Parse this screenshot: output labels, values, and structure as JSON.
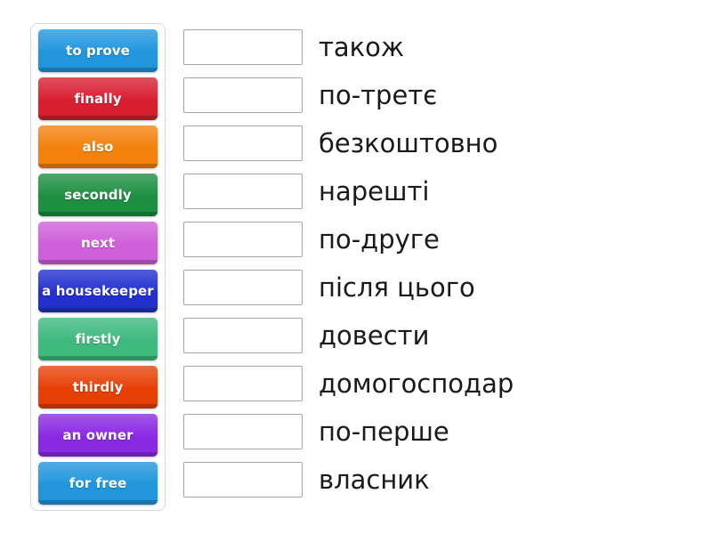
{
  "activity": {
    "type": "match-up",
    "background_color": "#ffffff"
  },
  "tile_tray": {
    "name": "draggable-tiles",
    "tiles": [
      {
        "label": "to prove",
        "color": "#2196dd",
        "text_color": "#ffffff"
      },
      {
        "label": "finally",
        "color": "#d81f32",
        "text_color": "#ffffff"
      },
      {
        "label": "also",
        "color": "#f4810c",
        "text_color": "#ffffff"
      },
      {
        "label": "secondly",
        "color": "#1d8f41",
        "text_color": "#ffffff"
      },
      {
        "label": "next",
        "color": "#d05fdb",
        "text_color": "#ffffff"
      },
      {
        "label": "a housekeeper",
        "color": "#2330cf",
        "text_color": "#ffffff"
      },
      {
        "label": "firstly",
        "color": "#3eba7f",
        "text_color": "#ffffff"
      },
      {
        "label": "thirdly",
        "color": "#e74007",
        "text_color": "#ffffff"
      },
      {
        "label": "an owner",
        "color": "#8a29e2",
        "text_color": "#ffffff"
      },
      {
        "label": "for free",
        "color": "#2196dd",
        "text_color": "#ffffff"
      }
    ]
  },
  "match_list": {
    "name": "answer-rows",
    "rows": [
      {
        "answer": "",
        "prompt": "також"
      },
      {
        "answer": "",
        "prompt": "по-третє"
      },
      {
        "answer": "",
        "prompt": "безкоштовно"
      },
      {
        "answer": "",
        "prompt": "нарешті"
      },
      {
        "answer": "",
        "prompt": "по-друге"
      },
      {
        "answer": "",
        "prompt": "після цього"
      },
      {
        "answer": "",
        "prompt": "довести"
      },
      {
        "answer": "",
        "prompt": "домогосподар"
      },
      {
        "answer": "",
        "prompt": "по-перше"
      },
      {
        "answer": "",
        "prompt": "власник"
      }
    ]
  }
}
